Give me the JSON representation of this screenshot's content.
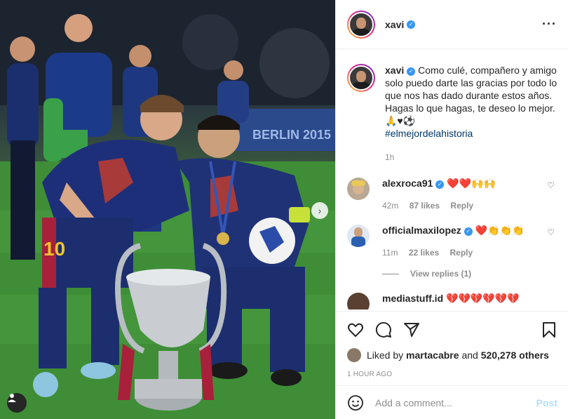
{
  "post": {
    "username": "xavi",
    "verified_icon": "verified-badge-icon",
    "more_icon": "more-options-icon"
  },
  "caption": {
    "username": "xavi",
    "text": "Como culé, compañero y amigo solo puedo darte las gracias por todo lo que nos has dado durante estos años. Hagas lo que hagas, te deseo lo mejor. 🙏♥⚽",
    "hashtag": "#elmejordelahistoria",
    "time": "1h"
  },
  "comments": [
    {
      "username": "alexroca91",
      "text": "❤️❤️🙌🙌",
      "time": "42m",
      "likes": "87 likes",
      "reply": "Reply"
    },
    {
      "username": "officialmaxilopez",
      "text": "❤️👏👏👏",
      "time": "11m",
      "likes": "22 likes",
      "reply": "Reply",
      "view_replies": "View replies (1)"
    },
    {
      "username": "mediastuff.id",
      "text": "💔💔💔💔💔💔"
    }
  ],
  "likes": {
    "prefix": "Liked by",
    "user": "martacabre",
    "and": "and",
    "others": "520,278 others"
  },
  "post_time": "1 HOUR AGO",
  "add_comment": {
    "placeholder": "Add a comment...",
    "post_label": "Post"
  },
  "photo": {
    "jersey_number": "10",
    "banner_text": "BERLIN 2015"
  },
  "colors": {
    "accent": "#3897f0",
    "heart": "#e0245e",
    "hashtag": "#00376b",
    "post_disabled": "#b2dffc"
  }
}
